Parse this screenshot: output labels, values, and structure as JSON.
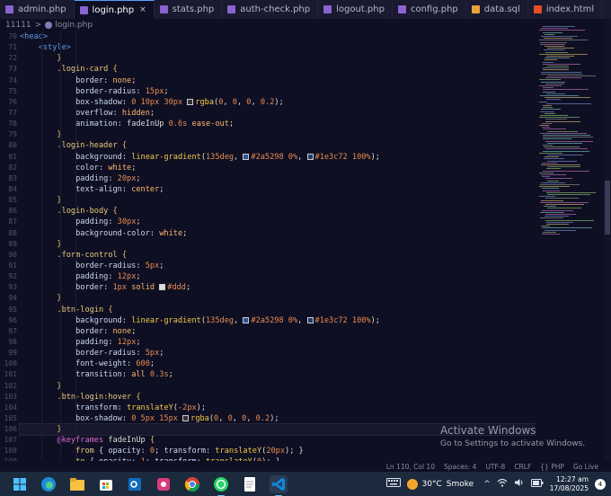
{
  "tabs": [
    {
      "label": "admin.php",
      "icon": "php-icon",
      "color": "#8a63d2",
      "active": false
    },
    {
      "label": "login.php",
      "icon": "php-icon",
      "color": "#8a63d2",
      "active": true
    },
    {
      "label": "stats.php",
      "icon": "php-icon",
      "color": "#8a63d2",
      "active": false
    },
    {
      "label": "auth-check.php",
      "icon": "php-icon",
      "color": "#8a63d2",
      "active": false
    },
    {
      "label": "logout.php",
      "icon": "php-icon",
      "color": "#8a63d2",
      "active": false
    },
    {
      "label": "config.php",
      "icon": "php-icon",
      "color": "#8a63d2",
      "active": false
    },
    {
      "label": "data.sql",
      "icon": "sql-icon",
      "color": "#e8a33c",
      "active": false
    },
    {
      "label": "index.html",
      "icon": "html-icon",
      "color": "#e44d26",
      "active": false
    }
  ],
  "tab_close_glyph": "×",
  "breadcrumb": {
    "folder": "11111",
    "separator": ">",
    "file": "login.php"
  },
  "line_numbers": [
    "70",
    "71",
    "72",
    "73",
    "74",
    "75",
    "76",
    "77",
    "78",
    "79",
    "80",
    "81",
    "82",
    "83",
    "84",
    "85",
    "86",
    "87",
    "88",
    "89",
    "90",
    "91",
    "92",
    "93",
    "94",
    "95",
    "96",
    "97",
    "98",
    "99",
    "100",
    "101",
    "102",
    "103",
    "104",
    "105",
    "106",
    "107",
    "108",
    "109",
    "110",
    "111",
    "112",
    "113"
  ],
  "active_line_index": 40,
  "status": {
    "position": "Ln 110, Col 10",
    "spaces": "Spaces: 4",
    "encoding": "UTF-8",
    "eol": "CRLF",
    "language": "{} PHP",
    "go_live": "Go Live"
  },
  "watermark": {
    "title": "Activate Windows",
    "subtitle": "Go to Settings to activate Windows."
  },
  "taskbar": {
    "apps": [
      "windows-start-icon",
      "edge-icon",
      "file-explorer-icon",
      "microsoft-store-icon",
      "outlook-icon",
      "photos-icon",
      "chrome-icon",
      "whatsapp-icon",
      "notepad-icon",
      "vscode-icon"
    ],
    "weather": {
      "temp": "30°C",
      "condition": "Smoke"
    },
    "time": "12:27 am",
    "date": "17/08/2025",
    "notifications": "4"
  },
  "colors": {
    "editor_bg": "#0f0f23",
    "accent": "#4fa3ff",
    "taskbar": "#1c2a3e"
  }
}
